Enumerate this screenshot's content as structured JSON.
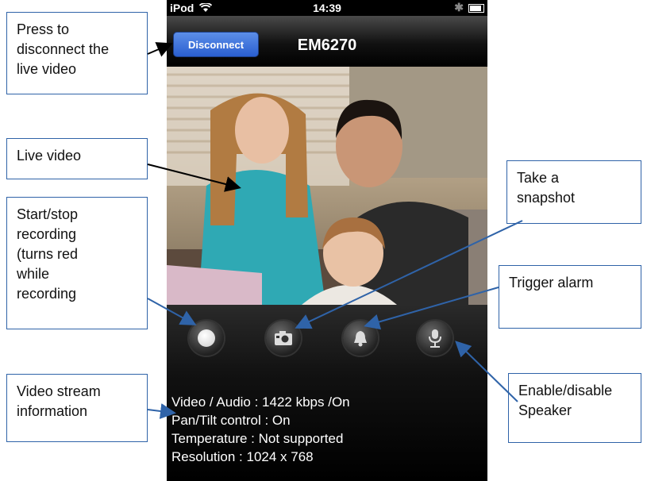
{
  "status_bar": {
    "carrier": "iPod",
    "time": "14:39"
  },
  "nav": {
    "disconnect_label": "Disconnect",
    "title": "EM6270"
  },
  "stream_info": {
    "lines": [
      "Video / Audio : 1422 kbps /On",
      "Pan/Tilt control : On",
      "Temperature : Not supported",
      "Resolution : 1024 x 768"
    ]
  },
  "callouts": {
    "disconnect": [
      "Press to",
      "disconnect the",
      "live video"
    ],
    "live_video": [
      "Live video"
    ],
    "record": [
      "Start/stop",
      "recording",
      "(turns red",
      "while",
      "recording"
    ],
    "stream_info": [
      "Video stream",
      "information"
    ],
    "snapshot": [
      "Take a",
      "snapshot"
    ],
    "alarm": [
      "Trigger alarm"
    ],
    "speaker": [
      "Enable/disable",
      "Speaker"
    ]
  },
  "colors": {
    "callout_border": "#2f63a8",
    "nav_button": "#2a5fd0"
  },
  "icons": [
    "wifi-icon",
    "bluetooth-icon",
    "battery-icon",
    "record-icon",
    "camera-icon",
    "bell-icon",
    "speaker-icon"
  ]
}
